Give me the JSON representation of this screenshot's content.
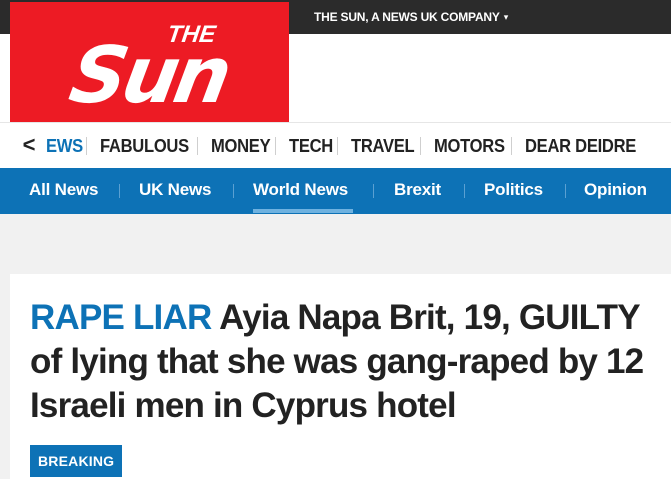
{
  "topbar": {
    "company_link": "THE SUN, A NEWS UK COMPANY",
    "caret": "▾"
  },
  "logo": {
    "small_text": "THE",
    "big_text": "Sun"
  },
  "section_nav": {
    "back": "<",
    "items": [
      {
        "label": "EWS",
        "active": true
      },
      {
        "label": "FABULOUS",
        "active": false
      },
      {
        "label": "MONEY",
        "active": false
      },
      {
        "label": "TECH",
        "active": false
      },
      {
        "label": "TRAVEL",
        "active": false
      },
      {
        "label": "MOTORS",
        "active": false
      },
      {
        "label": "DEAR DEIDRE",
        "active": false
      }
    ]
  },
  "sub_nav": {
    "items": [
      {
        "label": "All News",
        "active": false
      },
      {
        "label": "UK News",
        "active": false
      },
      {
        "label": "World News",
        "active": true
      },
      {
        "label": "Brexit",
        "active": false
      },
      {
        "label": "Politics",
        "active": false
      },
      {
        "label": "Opinion",
        "active": false
      }
    ]
  },
  "article": {
    "kicker": "RAPE LIAR",
    "headline": "Ayia Napa Brit, 19, GUILTY of lying that she was gang-raped by 12 Israeli men in Cyprus hotel",
    "badge": "BREAKING"
  },
  "colors": {
    "brand_red": "#ed1b24",
    "accent_blue": "#0d72b6",
    "topbar": "#2b2b2b"
  }
}
